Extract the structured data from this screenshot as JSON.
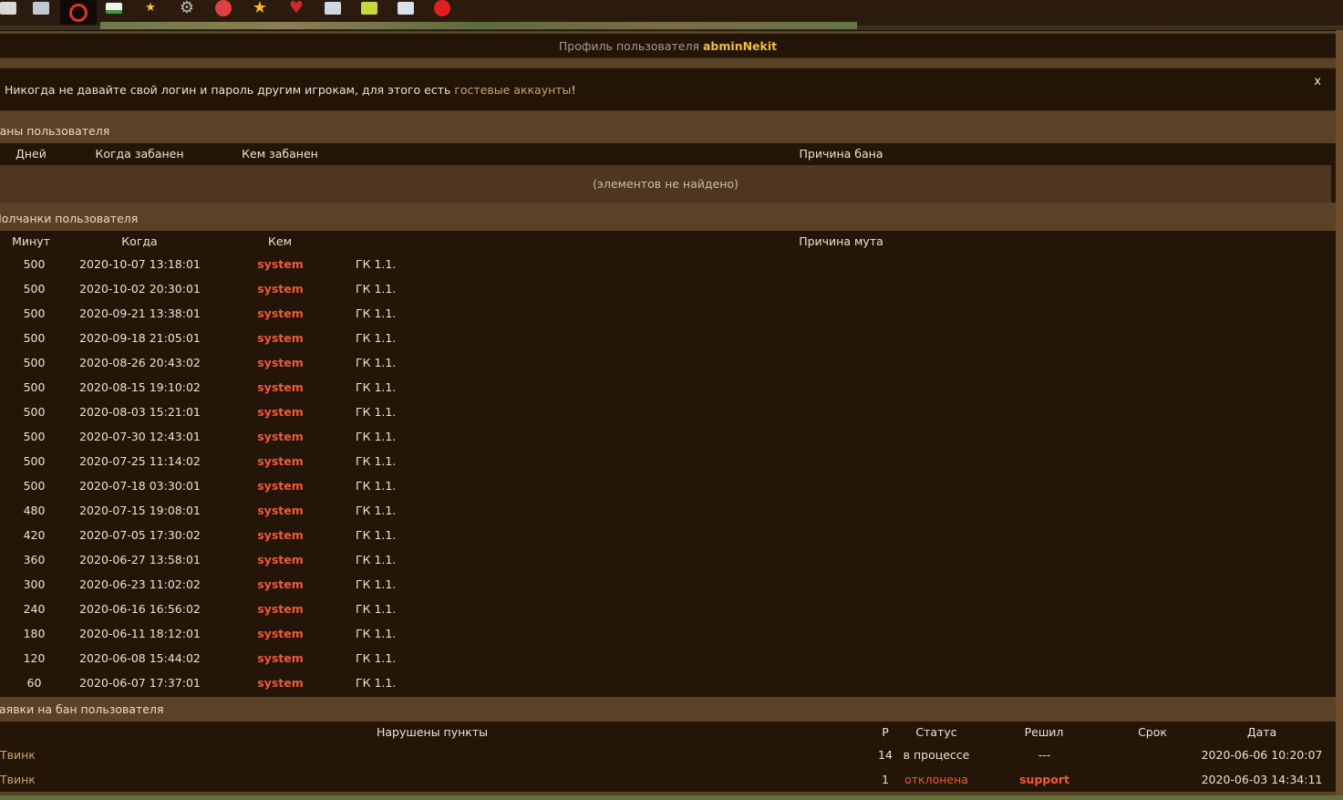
{
  "toolbar": {
    "icons": [
      {
        "name": "save-icon",
        "color": "#d8d8d8"
      },
      {
        "name": "home-icon",
        "color": "#c0c8d0"
      },
      {
        "name": "block-icon",
        "color": "#e23030"
      },
      {
        "name": "flag-icon",
        "color": "#3c9a3c"
      },
      {
        "name": "star-small-icon",
        "color": "#f0d030"
      },
      {
        "name": "gear-icon",
        "color": "#bcbcbc"
      },
      {
        "name": "clock-icon",
        "color": "#e04040"
      },
      {
        "name": "star-icon",
        "color": "#f5b81e"
      },
      {
        "name": "heart-icon",
        "color": "#d02828"
      },
      {
        "name": "stats-icon",
        "color": "#cfd8e0"
      },
      {
        "name": "edit-icon",
        "color": "#c8d640"
      },
      {
        "name": "list-icon",
        "color": "#d8e0ea"
      },
      {
        "name": "stop-icon",
        "color": "#e02020"
      }
    ]
  },
  "header": {
    "label": "Профиль пользователя",
    "username": "abminNekit"
  },
  "notice": {
    "text_before": "Никогда не давайте свой логин и пароль другим игрокам, для этого есть ",
    "link": "гостевые аккаунты",
    "text_after": "!",
    "close": "x"
  },
  "bans": {
    "title": "Баны пользователя",
    "columns": [
      "Дней",
      "Когда забанен",
      "Кем забанен",
      "Причина бана"
    ],
    "empty": "(элементов не найдено)"
  },
  "mutes": {
    "title": "Молчанки пользователя",
    "columns": [
      "Минут",
      "Когда",
      "Кем",
      "Причина мута"
    ],
    "rows": [
      {
        "min": "500",
        "when": "2020-10-07 13:18:01",
        "by": "system",
        "reason": "ГК 1.1."
      },
      {
        "min": "500",
        "when": "2020-10-02 20:30:01",
        "by": "system",
        "reason": "ГК 1.1."
      },
      {
        "min": "500",
        "when": "2020-09-21 13:38:01",
        "by": "system",
        "reason": "ГК 1.1."
      },
      {
        "min": "500",
        "when": "2020-09-18 21:05:01",
        "by": "system",
        "reason": "ГК 1.1."
      },
      {
        "min": "500",
        "when": "2020-08-26 20:43:02",
        "by": "system",
        "reason": "ГК 1.1."
      },
      {
        "min": "500",
        "when": "2020-08-15 19:10:02",
        "by": "system",
        "reason": "ГК 1.1."
      },
      {
        "min": "500",
        "when": "2020-08-03 15:21:01",
        "by": "system",
        "reason": "ГК 1.1."
      },
      {
        "min": "500",
        "when": "2020-07-30 12:43:01",
        "by": "system",
        "reason": "ГК 1.1."
      },
      {
        "min": "500",
        "when": "2020-07-25 11:14:02",
        "by": "system",
        "reason": "ГК 1.1."
      },
      {
        "min": "500",
        "when": "2020-07-18 03:30:01",
        "by": "system",
        "reason": "ГК 1.1."
      },
      {
        "min": "480",
        "when": "2020-07-15 19:08:01",
        "by": "system",
        "reason": "ГК 1.1."
      },
      {
        "min": "420",
        "when": "2020-07-05 17:30:02",
        "by": "system",
        "reason": "ГК 1.1."
      },
      {
        "min": "360",
        "when": "2020-06-27 13:58:01",
        "by": "system",
        "reason": "ГК 1.1."
      },
      {
        "min": "300",
        "when": "2020-06-23 11:02:02",
        "by": "system",
        "reason": "ГК 1.1."
      },
      {
        "min": "240",
        "when": "2020-06-16 16:56:02",
        "by": "system",
        "reason": "ГК 1.1."
      },
      {
        "min": "180",
        "when": "2020-06-11 18:12:01",
        "by": "system",
        "reason": "ГК 1.1."
      },
      {
        "min": "120",
        "when": "2020-06-08 15:44:02",
        "by": "system",
        "reason": "ГК 1.1."
      },
      {
        "min": "60",
        "when": "2020-06-07 17:37:01",
        "by": "system",
        "reason": "ГК 1.1."
      }
    ]
  },
  "requests": {
    "title": "Заявки на бан пользователя",
    "columns": [
      "Нарушены пункты",
      "Р",
      "Статус",
      "Решил",
      "Срок",
      "Дата"
    ],
    "rows": [
      {
        "points": "Твинк",
        "p": "14",
        "status": "в процессе",
        "decided": "---",
        "term": "",
        "date": "2020-06-06 10:20:07"
      },
      {
        "points": "Твинк",
        "p": "1",
        "status": "отклонена",
        "decided": "support",
        "term": "",
        "date": "2020-06-03 14:34:11"
      }
    ]
  }
}
